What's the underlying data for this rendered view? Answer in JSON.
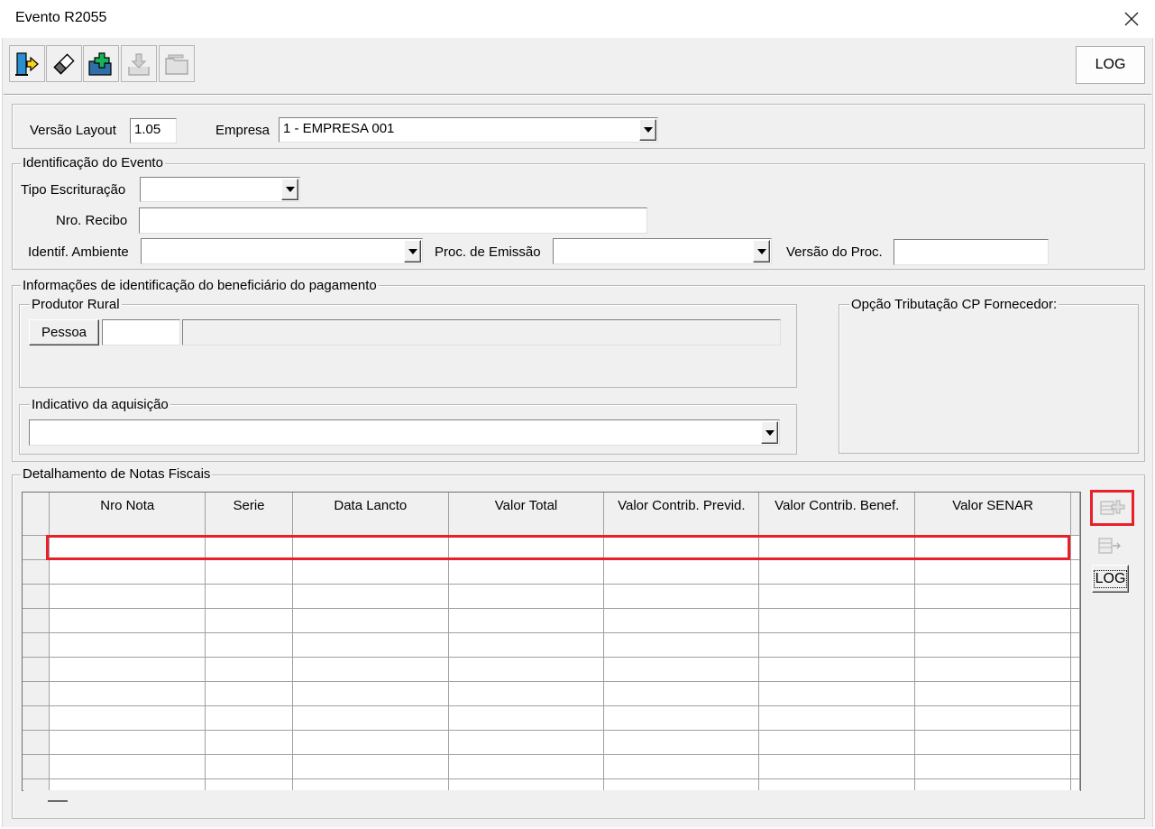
{
  "window": {
    "title": "Evento R2055",
    "close_icon": "close-icon"
  },
  "toolbar": {
    "buttons": [
      {
        "name": "exit-button",
        "icon": "exit-door-icon",
        "enabled": true
      },
      {
        "name": "clear-button",
        "icon": "eraser-icon",
        "enabled": true
      },
      {
        "name": "new-button",
        "icon": "add-folder-icon",
        "enabled": true
      },
      {
        "name": "import-button",
        "icon": "download-tray-icon",
        "enabled": false
      },
      {
        "name": "open-button",
        "icon": "folder-icon",
        "enabled": false
      }
    ],
    "log_label": "LOG"
  },
  "header": {
    "versao_label": "Versão Layout",
    "versao_value": "1.05",
    "empresa_label": "Empresa",
    "empresa_value": "1 - EMPRESA 001"
  },
  "identificacao": {
    "legend": "Identificação do Evento",
    "tipo_label": "Tipo Escrituração",
    "tipo_value": "",
    "recibo_label": "Nro. Recibo",
    "recibo_value": "",
    "ambiente_label": "Identif. Ambiente",
    "ambiente_value": "",
    "emissao_label": "Proc. de Emissão",
    "emissao_value": "",
    "versao_proc_label": "Versão do Proc.",
    "versao_proc_value": ""
  },
  "beneficiario": {
    "legend": "Informações de identificação do beneficiário do pagamento",
    "produtor_legend": "Produtor Rural",
    "pessoa_button": "Pessoa",
    "pessoa_code": "",
    "pessoa_name": "",
    "indicativo_legend": "Indicativo da aquisição",
    "indicativo_value": "",
    "opcao_legend": "Opção Tributação CP Fornecedor:"
  },
  "notas": {
    "legend": "Detalhamento de Notas Fiscais",
    "columns": [
      "Nro Nota",
      "Serie",
      "Data Lancto",
      "Valor Total",
      "Valor Contrib. Previd.",
      "Valor Contrib. Benef.",
      "Valor SENAR"
    ],
    "log_label": "LOG",
    "add_icon": "add-row-icon",
    "export_icon": "export-row-icon"
  },
  "colors": {
    "highlight": "#e8202a",
    "window_bg": "#f0f0f0"
  }
}
